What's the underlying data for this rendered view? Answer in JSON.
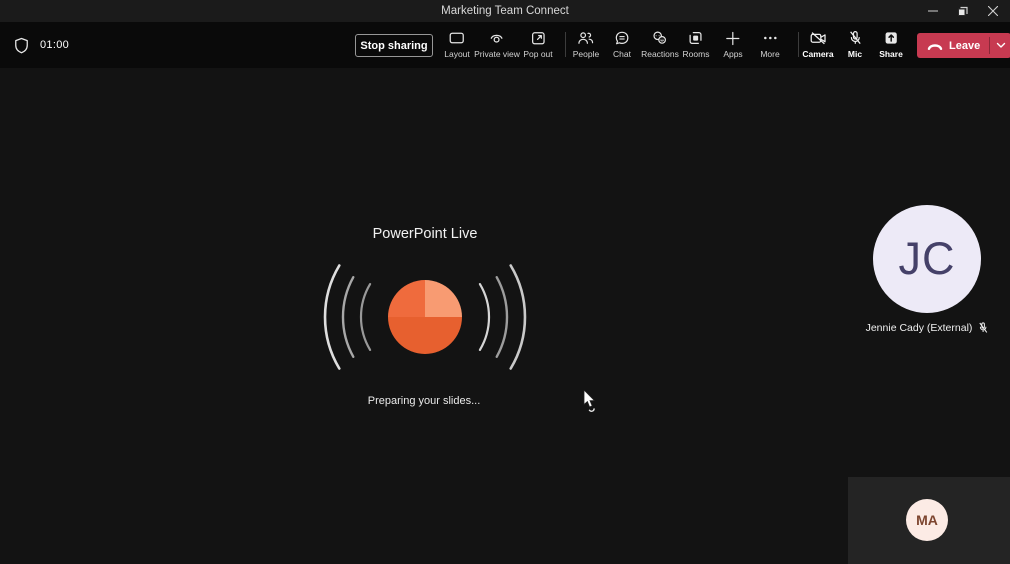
{
  "window": {
    "title": "Marketing Team Connect"
  },
  "toolbar": {
    "timer": "01:00",
    "stop_sharing_label": "Stop sharing",
    "view_tools": [
      {
        "label": "Layout"
      },
      {
        "label": "Private view"
      },
      {
        "label": "Pop out"
      }
    ],
    "meeting_tools": [
      {
        "label": "People"
      },
      {
        "label": "Chat"
      },
      {
        "label": "Reactions"
      },
      {
        "label": "Rooms"
      },
      {
        "label": "Apps"
      },
      {
        "label": "More"
      }
    ],
    "device_tools": [
      {
        "label": "Camera",
        "state": "off"
      },
      {
        "label": "Mic",
        "state": "muted"
      },
      {
        "label": "Share",
        "state": "sharing"
      }
    ],
    "leave_label": "Leave"
  },
  "stage": {
    "heading": "PowerPoint Live",
    "status": "Preparing your slides...",
    "participant": {
      "initials": "JC",
      "name": "Jennie Cady (External)",
      "muted": true
    },
    "self_view": {
      "initials": "MA"
    }
  },
  "colors": {
    "leave_red": "#c73a51",
    "ppt_top_left": "#ef6b3d",
    "ppt_top_right": "#f89b72",
    "ppt_bottom": "#e7602f",
    "participant_avatar_bg": "#edeaf7",
    "participant_initials": "#454169",
    "self_avatar_bg": "#fcebe5",
    "self_initials": "#7d452f"
  }
}
